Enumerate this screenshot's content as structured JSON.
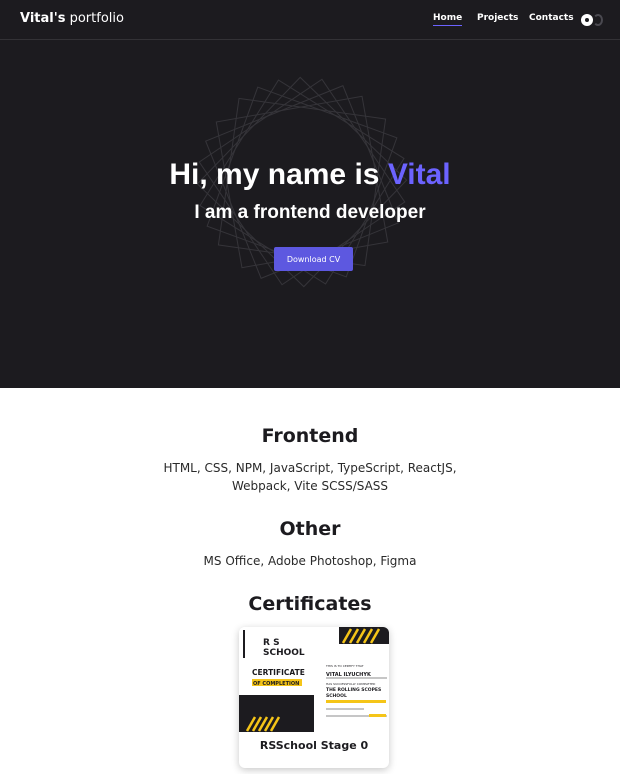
{
  "header": {
    "brand_bold": "Vital's",
    "brand_rest": "portfolio",
    "nav": [
      "Home",
      "Projects",
      "Contacts"
    ],
    "active_nav": "Home"
  },
  "hero": {
    "title_prefix": "Hi, my name is",
    "title_name": "Vital",
    "subtitle": "I am a frontend developer",
    "cv_button": "Download CV"
  },
  "skills": [
    {
      "title": "Frontend",
      "lines": [
        "HTML, CSS, NPM, JavaScript, TypeScript, ReactJS,",
        "Webpack, Vite SCSS/SASS"
      ]
    },
    {
      "title": "Other",
      "lines": [
        "MS Office, Adobe Photoshop, Figma"
      ]
    }
  ],
  "certificates": {
    "title": "Certificates",
    "items": [
      {
        "caption": "RSSchool Stage 0",
        "image": {
          "logo_line1": "R S",
          "logo_line2": "SCHOOL",
          "heading": "CERTIFICATE",
          "subheading": "OF COMPLETION",
          "awarded_label": "THIS IS TO CERTIFY THAT",
          "recipient": "VITAL ILYUCHYK",
          "school_label": "HAS SUCCESSFULLY COMPLETED",
          "school_line1": "THE ROLLING SCOPES",
          "school_line2": "SCHOOL"
        }
      }
    ]
  },
  "colors": {
    "dark_bg": "#1c1b1f",
    "accent": "#6c63ff",
    "button": "#5d58e0",
    "cert_yellow": "#f5c518"
  },
  "icons": {
    "theme_light": "sun-icon",
    "theme_dark": "moon-icon"
  }
}
